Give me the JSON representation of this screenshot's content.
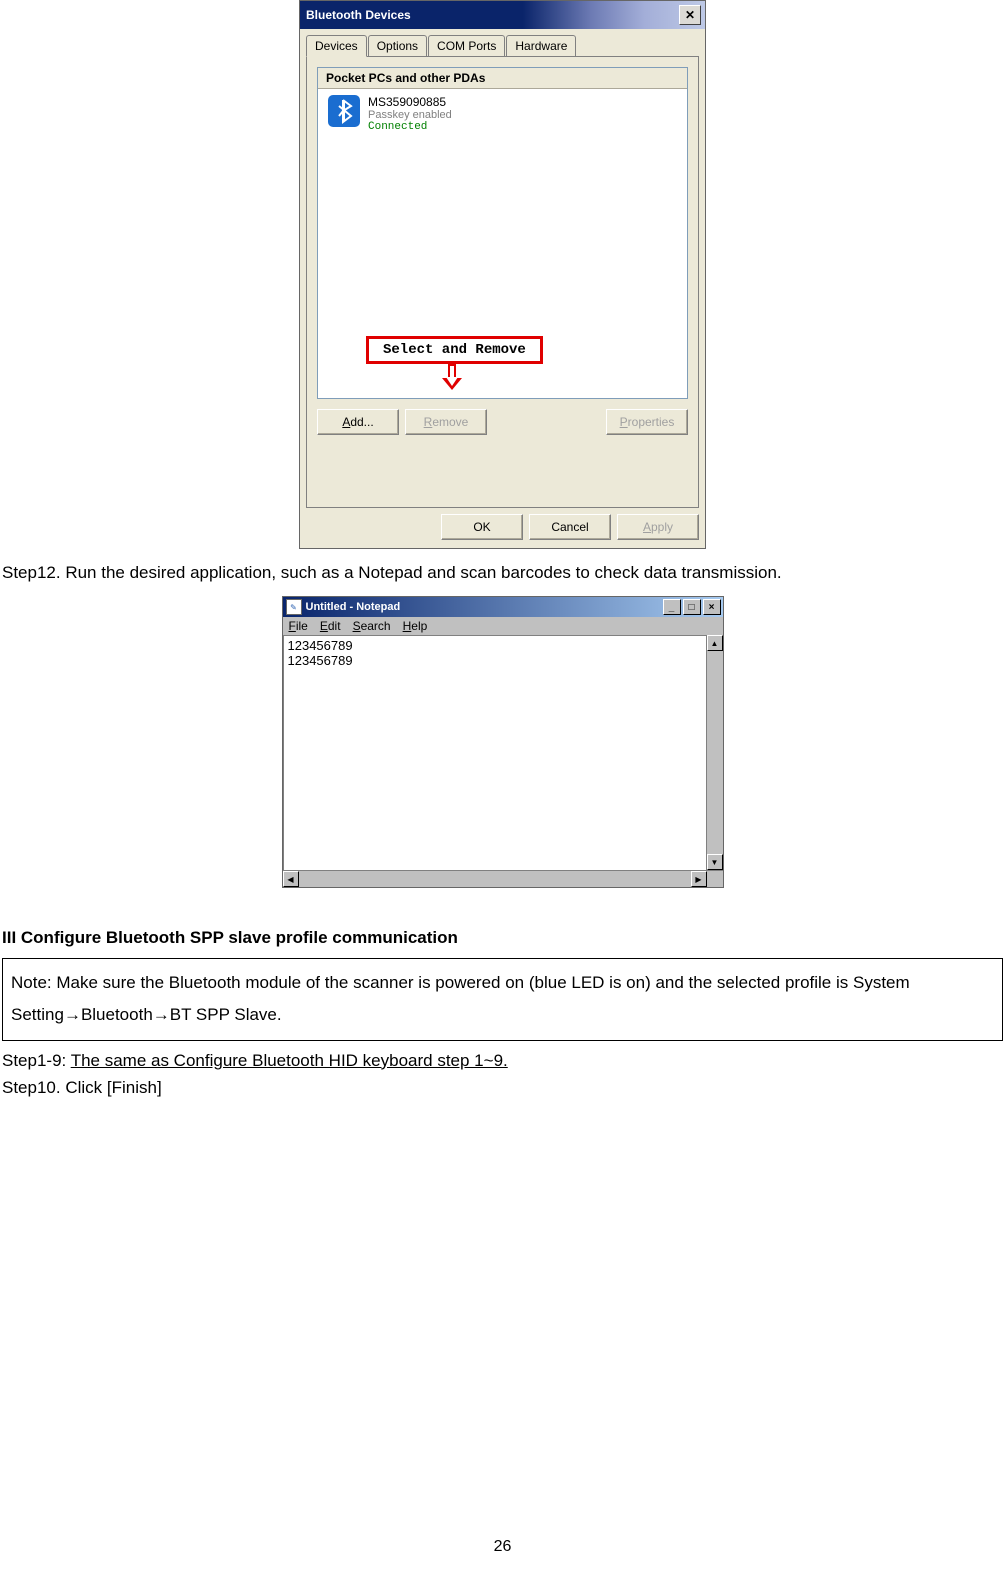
{
  "bluetooth_dialog": {
    "title": "Bluetooth Devices",
    "close_x": "✕",
    "tabs": [
      "Devices",
      "Options",
      "COM Ports",
      "Hardware"
    ],
    "list_header": "Pocket PCs and other PDAs",
    "device": {
      "name": "MS359090885",
      "subtitle": "Passkey enabled",
      "status": "Connected"
    },
    "callout": "Select and Remove",
    "buttons": {
      "add": "Add...",
      "remove": "Remove",
      "properties": "Properties",
      "ok": "OK",
      "cancel": "Cancel",
      "apply": "Apply"
    }
  },
  "step12_text": "Step12. Run the desired application, such as a Notepad and scan barcodes to check data transmission.",
  "notepad": {
    "title": "Untitled - Notepad",
    "menus": {
      "file": "File",
      "edit": "Edit",
      "search": "Search",
      "help": "Help"
    },
    "content": "123456789\n123456789"
  },
  "section3_heading": "III  Configure Bluetooth SPP slave profile communication",
  "note_box_pre": "Note: Make sure the Bluetooth module of the scanner is powered on (blue LED is on) and the selected profile is System Setting",
  "note_box_mid1": "Bluetooth",
  "note_box_post": "BT SPP Slave.",
  "arrow": "→",
  "step1_9_pre": "Step1-9: ",
  "step1_9_link": "The same as Configure Bluetooth HID keyboard step 1~9.",
  "step10": "Step10. Click [Finish]",
  "page_number": "26"
}
